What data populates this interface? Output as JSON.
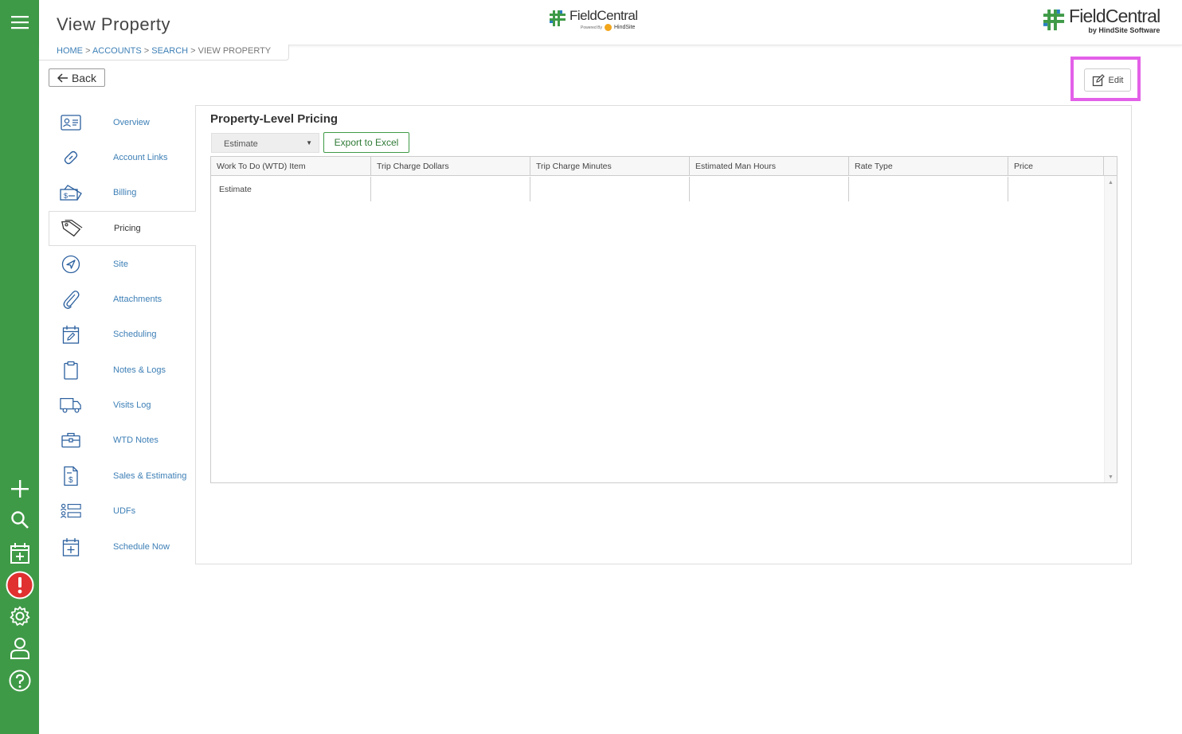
{
  "app": {
    "page_title": "View Property",
    "logo_center": {
      "name": "FieldCentral",
      "powered_by": "Powered By",
      "partner": "HindSite"
    },
    "logo_right": {
      "name": "FieldCentral",
      "byline": "by HindSite Software"
    }
  },
  "breadcrumb": {
    "home": "HOME",
    "accounts": "ACCOUNTS",
    "search": "SEARCH",
    "current": "VIEW PROPERTY",
    "sep": ">"
  },
  "actions": {
    "back_label": "Back",
    "edit_label": "Edit"
  },
  "nav": {
    "items": [
      {
        "label": "Overview",
        "icon": "contact-card-icon"
      },
      {
        "label": "Account Links",
        "icon": "link-icon"
      },
      {
        "label": "Billing",
        "icon": "billing-icon"
      },
      {
        "label": "Pricing",
        "icon": "price-tag-icon",
        "active": true
      },
      {
        "label": "Site",
        "icon": "navigation-icon"
      },
      {
        "label": "Attachments",
        "icon": "paperclip-icon"
      },
      {
        "label": "Scheduling",
        "icon": "calendar-edit-icon"
      },
      {
        "label": "Notes & Logs",
        "icon": "clipboard-icon"
      },
      {
        "label": "Visits Log",
        "icon": "truck-icon"
      },
      {
        "label": "WTD Notes",
        "icon": "briefcase-icon"
      },
      {
        "label": "Sales & Estimating",
        "icon": "invoice-icon"
      },
      {
        "label": "UDFs",
        "icon": "user-fields-icon"
      },
      {
        "label": "Schedule Now",
        "icon": "calendar-add-icon"
      }
    ]
  },
  "pricing": {
    "title": "Property-Level Pricing",
    "dropdown_value": "Estimate",
    "export_label": "Export to Excel",
    "columns": [
      "Work To Do (WTD) Item",
      "Trip Charge Dollars",
      "Trip Charge Minutes",
      "Estimated Man Hours",
      "Rate Type",
      "Price"
    ],
    "rows": [
      [
        "Estimate",
        "",
        "",
        "",
        "",
        ""
      ]
    ]
  },
  "colors": {
    "sidebar": "#3f9a47",
    "link": "#3d7fb6",
    "highlight": "#e360e8",
    "alert": "#e03030"
  }
}
